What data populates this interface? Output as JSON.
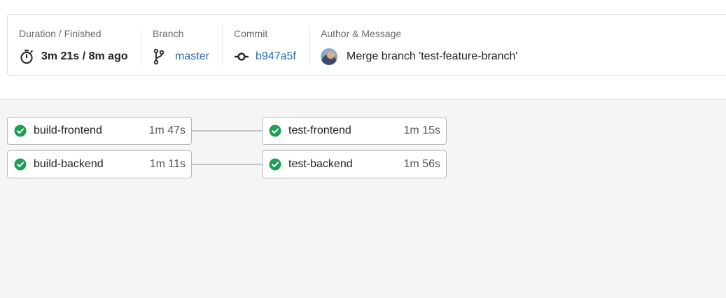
{
  "summary": {
    "duration": {
      "label": "Duration / Finished",
      "value": "3m 21s / 8m ago",
      "icon": "stopwatch-icon"
    },
    "branch": {
      "label": "Branch",
      "value": "master",
      "icon": "branch-icon"
    },
    "commit": {
      "label": "Commit",
      "value": "b947a5f",
      "icon": "commit-icon"
    },
    "author": {
      "label": "Author & Message",
      "message": "Merge branch 'test-feature-branch'"
    }
  },
  "colors": {
    "success": "#1f9d55",
    "link": "#2a6ea8"
  },
  "pipeline": {
    "stages": [
      {
        "jobs": [
          {
            "name": "build-frontend",
            "time": "1m 47s",
            "status": "success"
          },
          {
            "name": "build-backend",
            "time": "1m 11s",
            "status": "success"
          }
        ]
      },
      {
        "jobs": [
          {
            "name": "test-frontend",
            "time": "1m 15s",
            "status": "success"
          },
          {
            "name": "test-backend",
            "time": "1m 56s",
            "status": "success"
          }
        ]
      }
    ]
  }
}
